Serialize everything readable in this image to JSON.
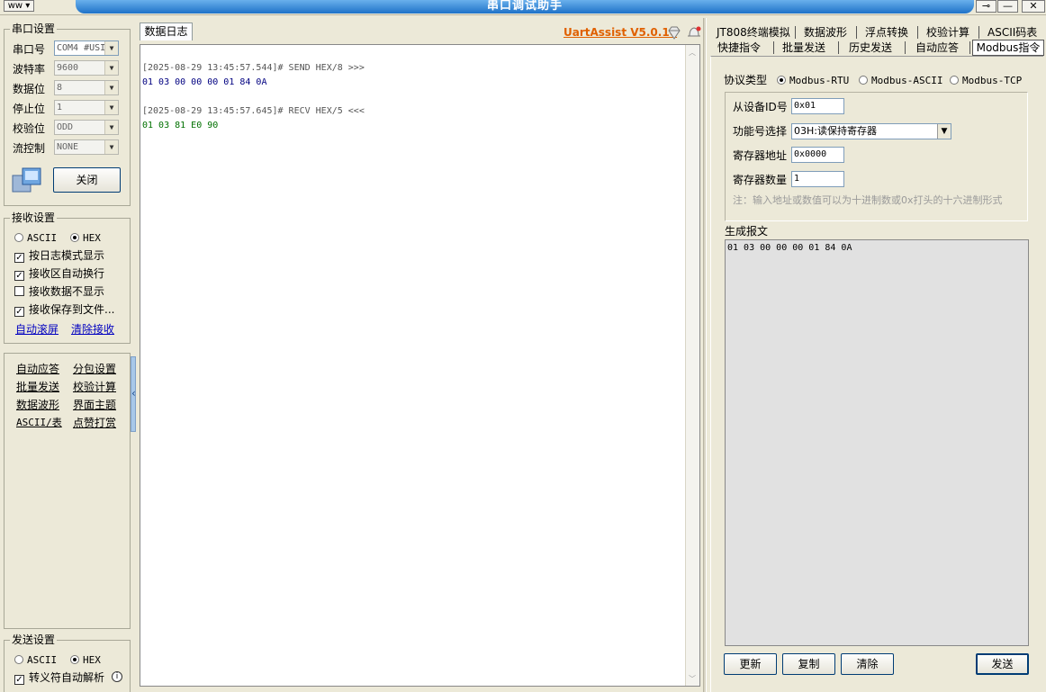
{
  "window": {
    "title": "串口调试助手",
    "pin_glyph": "⊸",
    "minimize_glyph": "—",
    "close_glyph": "✕",
    "sysmenu_label": "ᴡᴡ ▾"
  },
  "serial_settings": {
    "legend": "串口设置",
    "rows": [
      {
        "label": "串口号",
        "value": "COM4 #USI"
      },
      {
        "label": "波特率",
        "value": "9600"
      },
      {
        "label": "数据位",
        "value": "8"
      },
      {
        "label": "停止位",
        "value": "1"
      },
      {
        "label": "校验位",
        "value": "ODD"
      },
      {
        "label": "流控制",
        "value": "NONE"
      }
    ],
    "close_button": "关闭",
    "port_icon": "serial-port-icon"
  },
  "receive_settings": {
    "legend": "接收设置",
    "mode_ascii": "ASCII",
    "mode_hex": "HEX",
    "checks": [
      {
        "label": "按日志模式显示",
        "checked": true
      },
      {
        "label": "接收区自动换行",
        "checked": true
      },
      {
        "label": "接收数据不显示",
        "checked": false
      },
      {
        "label": "接收保存到文件...",
        "checked": true
      }
    ],
    "link_autoscroll": "自动滚屏",
    "link_clear": "清除接收"
  },
  "tools": {
    "links": [
      "自动应答",
      "分包设置",
      "批量发送",
      "校验计算",
      "数据波形",
      "界面主题",
      "ASCII/表",
      "点赞打赏"
    ],
    "collapse_glyph": "‹"
  },
  "send_settings": {
    "legend": "发送设置",
    "mode_ascii": "ASCII",
    "mode_hex": "HEX",
    "escape_check": "转义符自动解析",
    "info_glyph": "i"
  },
  "log": {
    "tab_label": "数据日志",
    "brand": "UartAssist V5.0.10",
    "entries": [
      {
        "header": "[2025-08-29 13:45:57.544]# SEND HEX/8 >>>",
        "data": "01 03 00 00 00 01 84 0A",
        "color": "#000080"
      },
      {
        "header": "[2025-08-29 13:45:57.645]# RECV HEX/5 <<<",
        "data": "01 03 81 E0 90",
        "color": "#007000"
      }
    ]
  },
  "right_tabs": {
    "row1": [
      "JT808终端模拟",
      "数据波形",
      "浮点转换",
      "校验计算",
      "ASCII码表"
    ],
    "row2": [
      "快捷指令",
      "批量发送",
      "历史发送",
      "自动应答",
      "Modbus指令"
    ]
  },
  "modbus": {
    "protocol_label": "协议类型",
    "protocols": [
      {
        "label": "Modbus-RTU",
        "selected": true
      },
      {
        "label": "Modbus-ASCII",
        "selected": false
      },
      {
        "label": "Modbus-TCP",
        "selected": false
      }
    ],
    "slave_id_label": "从设备ID号",
    "slave_id_value": "0x01",
    "function_label": "功能号选择",
    "function_value": "03H:读保持寄存器",
    "reg_addr_label": "寄存器地址",
    "reg_addr_value": "0x0000",
    "reg_count_label": "寄存器数量",
    "reg_count_value": "1",
    "note": "注：输入地址或数值可以为十进制数或0x打头的十六进制形式",
    "generated_label": "生成报文",
    "generated_value": "01 03 00 00 00 01 84 0A",
    "buttons": {
      "update": "更新",
      "copy": "复制",
      "clear": "清除",
      "send": "发送"
    }
  },
  "colors": {
    "title_bar": "#1f72c8",
    "brand": "#e06000",
    "send_text": "#000080",
    "recv_text": "#007000",
    "link": "#0000c0"
  }
}
